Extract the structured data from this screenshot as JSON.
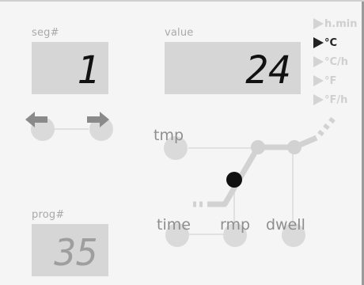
{
  "segment": {
    "label": "seg#",
    "value": "1"
  },
  "value_display": {
    "label": "value",
    "value": "24"
  },
  "program": {
    "label": "prog#",
    "value": "35"
  },
  "units": [
    {
      "label": "h.min",
      "active": false
    },
    {
      "label": "°C",
      "active": true
    },
    {
      "label": "°C/h",
      "active": false
    },
    {
      "label": "°F",
      "active": false
    },
    {
      "label": "°F/h",
      "active": false
    }
  ],
  "profile": {
    "tmp_label": "tmp",
    "time_label": "time",
    "rmp_label": "rmp",
    "dwell_label": "dwell"
  },
  "colors": {
    "display_bg": "#d6d6d6",
    "digit_active": "#111111",
    "digit_inactive": "#9e9e9e",
    "button": "#dadada",
    "active_unit": "#222222"
  },
  "icons": [
    "arrow-left-icon",
    "arrow-right-icon",
    "triangle-pointer-icon"
  ]
}
